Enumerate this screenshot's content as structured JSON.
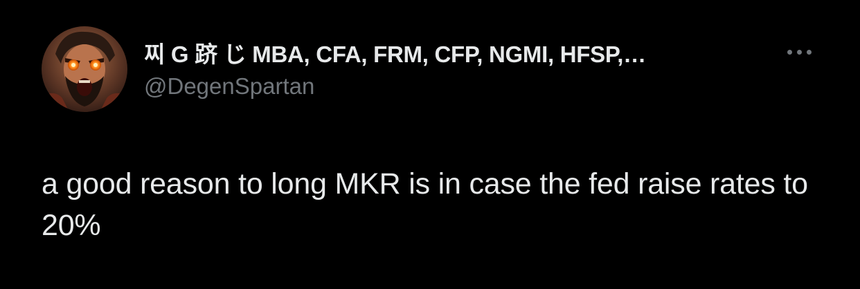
{
  "tweet": {
    "author": {
      "display_name": "찌 G 跻 じ MBA, CFA, FRM, CFP, NGMI, HFSP,…",
      "handle": "@DegenSpartan",
      "avatar_icon": "spartan-warrior-avatar-icon"
    },
    "more_icon": "more-horizontal-icon",
    "text": "a good reason to long MKR is in case the fed raise rates to 20%"
  },
  "colors": {
    "background": "#000000",
    "primary_text": "#e7e9ea",
    "secondary_text": "#71767b",
    "eye_glow": "#ff8a1c"
  }
}
